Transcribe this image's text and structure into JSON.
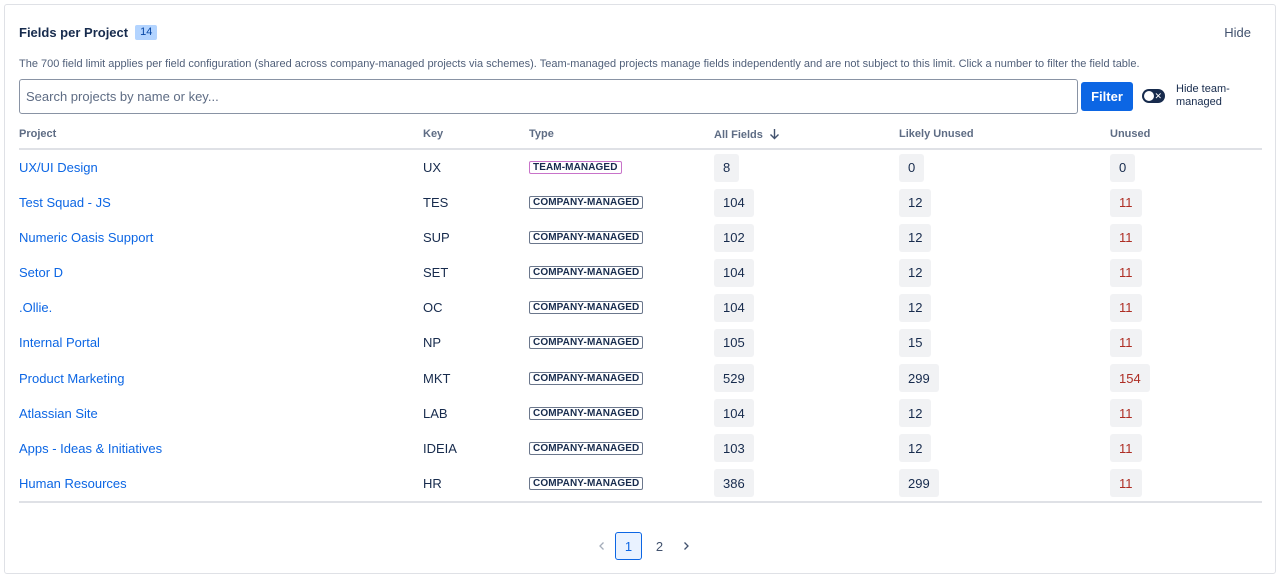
{
  "header": {
    "title": "Fields per Project",
    "count_badge": "14",
    "hide_label": "Hide",
    "description": "The 700 field limit applies per field configuration (shared across company-managed projects via schemes). Team-managed projects manage fields independently and are not subject to this limit. Click a number to filter the field table."
  },
  "search": {
    "placeholder": "Search projects by name or key...",
    "value": ""
  },
  "filter_button": "Filter",
  "toggle": {
    "label": "Hide team-managed",
    "checked": false
  },
  "table": {
    "columns": {
      "project": "Project",
      "key": "Key",
      "type": "Type",
      "all_fields": "All Fields",
      "likely_unused": "Likely Unused",
      "unused": "Unused"
    },
    "sort_column": "all_fields",
    "sort_direction": "descending",
    "rows": [
      {
        "project": "UX/UI Design",
        "key": "UX",
        "type": "TEAM-MANAGED",
        "all_fields": "8",
        "likely_unused": "0",
        "unused": "0"
      },
      {
        "project": "Test Squad - JS",
        "key": "TES",
        "type": "COMPANY-MANAGED",
        "all_fields": "104",
        "likely_unused": "12",
        "unused": "11"
      },
      {
        "project": "Numeric Oasis Support",
        "key": "SUP",
        "type": "COMPANY-MANAGED",
        "all_fields": "102",
        "likely_unused": "12",
        "unused": "11"
      },
      {
        "project": "Setor D",
        "key": "SET",
        "type": "COMPANY-MANAGED",
        "all_fields": "104",
        "likely_unused": "12",
        "unused": "11"
      },
      {
        "project": ".Ollie.",
        "key": "OC",
        "type": "COMPANY-MANAGED",
        "all_fields": "104",
        "likely_unused": "12",
        "unused": "11"
      },
      {
        "project": "Internal Portal",
        "key": "NP",
        "type": "COMPANY-MANAGED",
        "all_fields": "105",
        "likely_unused": "15",
        "unused": "11"
      },
      {
        "project": "Product Marketing",
        "key": "MKT",
        "type": "COMPANY-MANAGED",
        "all_fields": "529",
        "likely_unused": "299",
        "unused": "154"
      },
      {
        "project": "Atlassian Site",
        "key": "LAB",
        "type": "COMPANY-MANAGED",
        "all_fields": "104",
        "likely_unused": "12",
        "unused": "11"
      },
      {
        "project": "Apps - Ideas & Initiatives",
        "key": "IDEIA",
        "type": "COMPANY-MANAGED",
        "all_fields": "103",
        "likely_unused": "12",
        "unused": "11"
      },
      {
        "project": "Human Resources",
        "key": "HR",
        "type": "COMPANY-MANAGED",
        "all_fields": "386",
        "likely_unused": "299",
        "unused": "11"
      }
    ]
  },
  "pagination": {
    "pages": [
      "1",
      "2"
    ],
    "current": "1",
    "prev_icon": "chevron-left-icon",
    "next_icon": "chevron-right-icon"
  },
  "colors": {
    "link": "#0c66e4",
    "primary_button": "#0c66e4",
    "unused_red": "#ae2e24",
    "team_managed_border": "#c873c9"
  }
}
